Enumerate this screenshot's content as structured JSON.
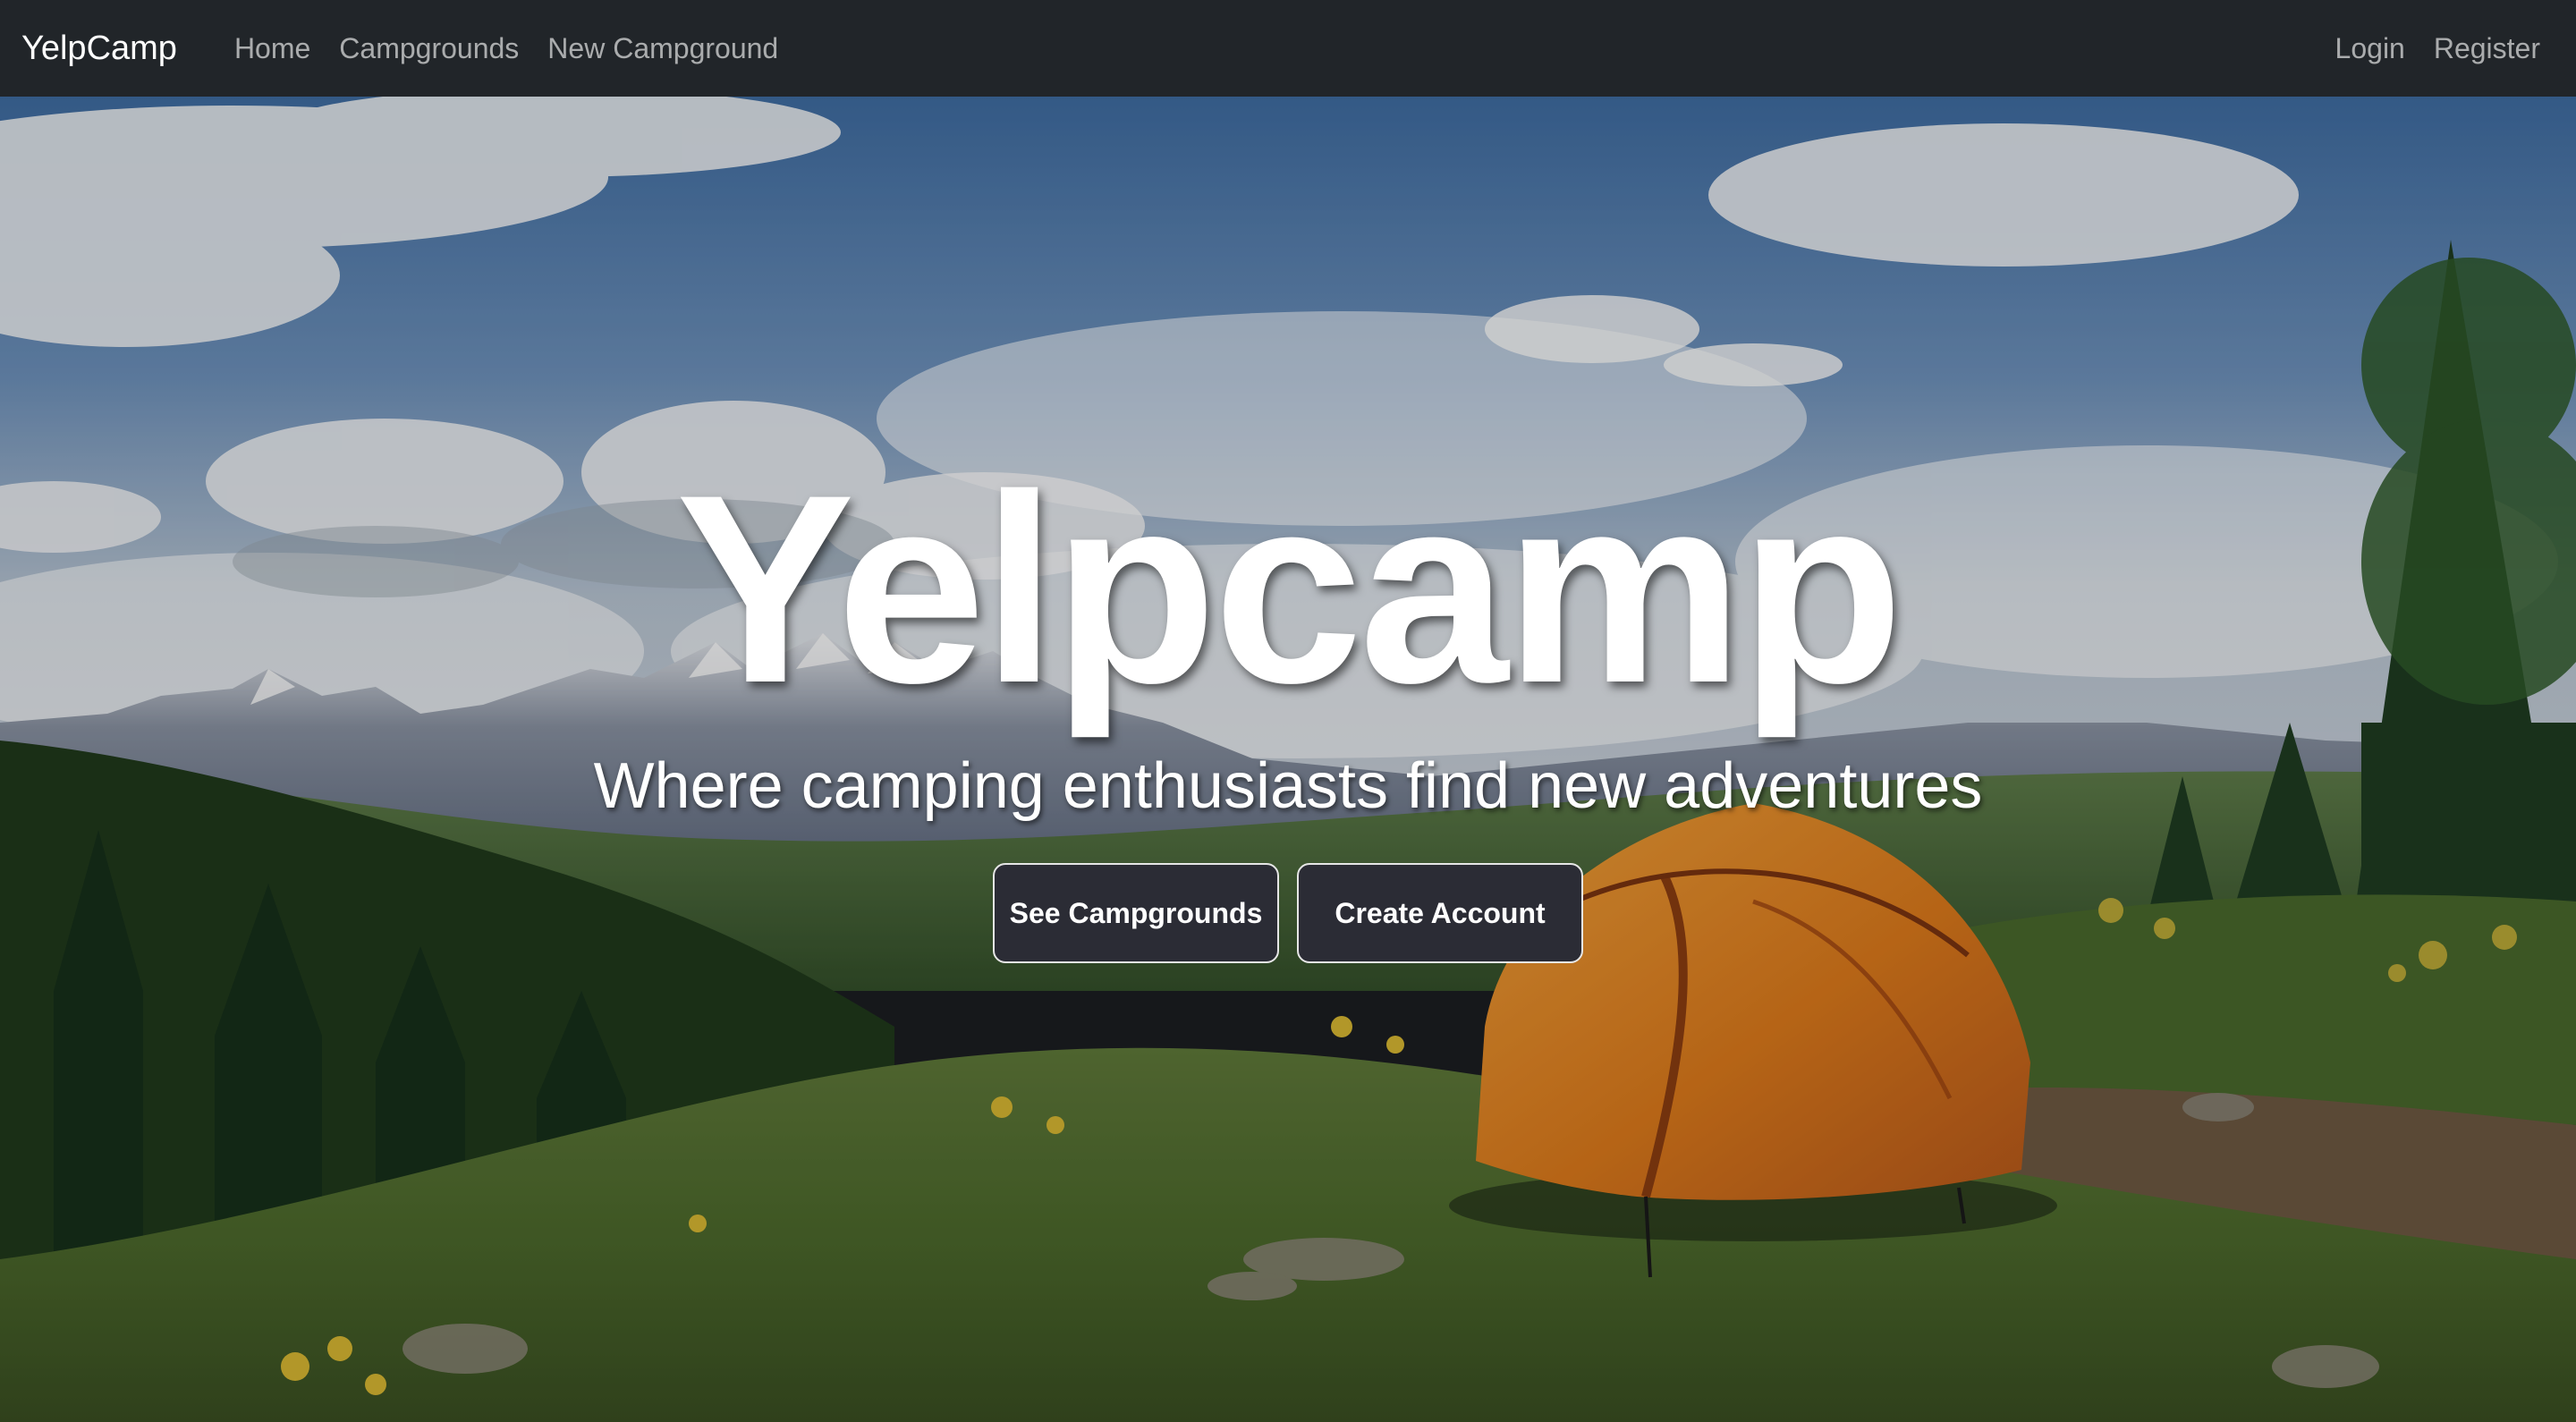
{
  "navbar": {
    "brand": "YelpCamp",
    "links": [
      "Home",
      "Campgrounds",
      "New Campground"
    ],
    "auth": [
      "Login",
      "Register"
    ]
  },
  "hero": {
    "title": "Yelpcamp",
    "subtitle": "Where camping enthusiasts find new adventures",
    "buttons": [
      "See Campgrounds",
      "Create Account"
    ]
  },
  "colors": {
    "navbar_bg": "#212529",
    "button_bg": "#2b2c35",
    "tent": "#e07a1f"
  }
}
